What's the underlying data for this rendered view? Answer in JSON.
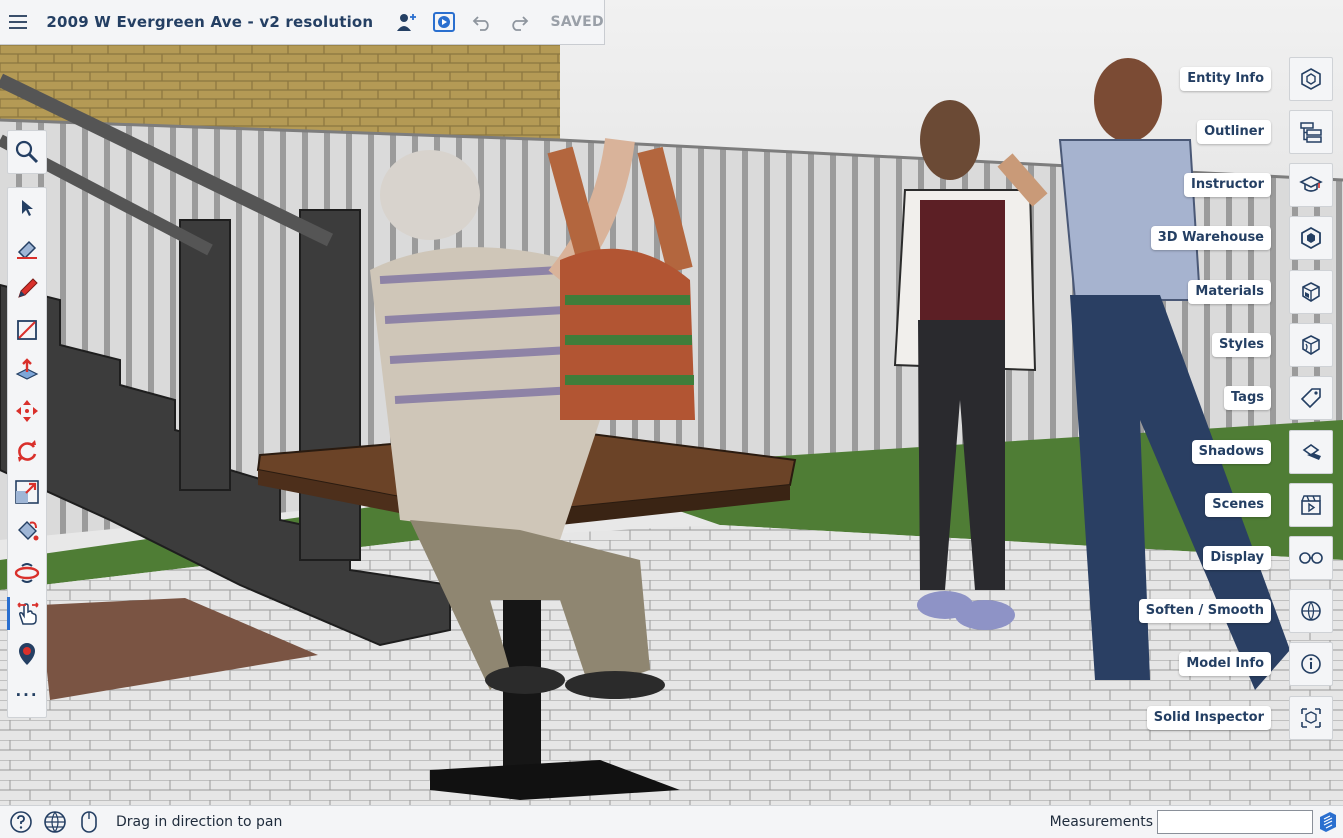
{
  "app": {
    "title": "2009 W Evergreen Ave - v2 resolution",
    "save_status": "SAVED"
  },
  "topbar": {
    "icons": [
      "menu-icon",
      "add-collaborator-icon",
      "present-icon",
      "undo-icon",
      "redo-icon"
    ]
  },
  "tools": [
    {
      "name": "search",
      "icon": "search-icon"
    },
    {
      "name": "select",
      "icon": "select-arrow-icon"
    },
    {
      "name": "eraser",
      "icon": "eraser-icon"
    },
    {
      "name": "pencil",
      "icon": "pencil-icon"
    },
    {
      "name": "rectangle",
      "icon": "rectangle-icon"
    },
    {
      "name": "push-pull",
      "icon": "push-pull-icon"
    },
    {
      "name": "move",
      "icon": "move-icon"
    },
    {
      "name": "rotate",
      "icon": "rotate-icon"
    },
    {
      "name": "scale",
      "icon": "scale-icon"
    },
    {
      "name": "paint-bucket",
      "icon": "paint-bucket-icon"
    },
    {
      "name": "orbit",
      "icon": "orbit-icon"
    },
    {
      "name": "pan",
      "icon": "pan-hand-icon",
      "active": true
    },
    {
      "name": "walk",
      "icon": "position-camera-icon"
    },
    {
      "name": "more",
      "icon": "more-dots-icon",
      "label": "..."
    }
  ],
  "trays": [
    {
      "label": "Entity Info",
      "icon": "entity-info-icon"
    },
    {
      "label": "Outliner",
      "icon": "outliner-icon"
    },
    {
      "label": "Instructor",
      "icon": "instructor-icon"
    },
    {
      "label": "3D Warehouse",
      "icon": "warehouse-icon"
    },
    {
      "label": "Materials",
      "icon": "materials-icon"
    },
    {
      "label": "Styles",
      "icon": "styles-icon"
    },
    {
      "label": "Tags",
      "icon": "tags-icon"
    },
    {
      "label": "Shadows",
      "icon": "shadows-icon"
    },
    {
      "label": "Scenes",
      "icon": "scenes-icon"
    },
    {
      "label": "Display",
      "icon": "display-glasses-icon"
    },
    {
      "label": "Soften / Smooth",
      "icon": "soften-smooth-icon"
    },
    {
      "label": "Model Info",
      "icon": "model-info-icon"
    },
    {
      "label": "Solid Inspector",
      "icon": "solid-inspector-icon"
    }
  ],
  "statusbar": {
    "hint": "Drag in direction to pan",
    "measurements_label": "Measurements",
    "measurements_value": "",
    "icons": [
      "help-icon",
      "globe-icon",
      "mouse-icon",
      "sketchup-logo-icon"
    ]
  },
  "colors": {
    "accent": "#2a6fcf",
    "tool_red": "#d9302b",
    "title_text": "#243f63"
  }
}
